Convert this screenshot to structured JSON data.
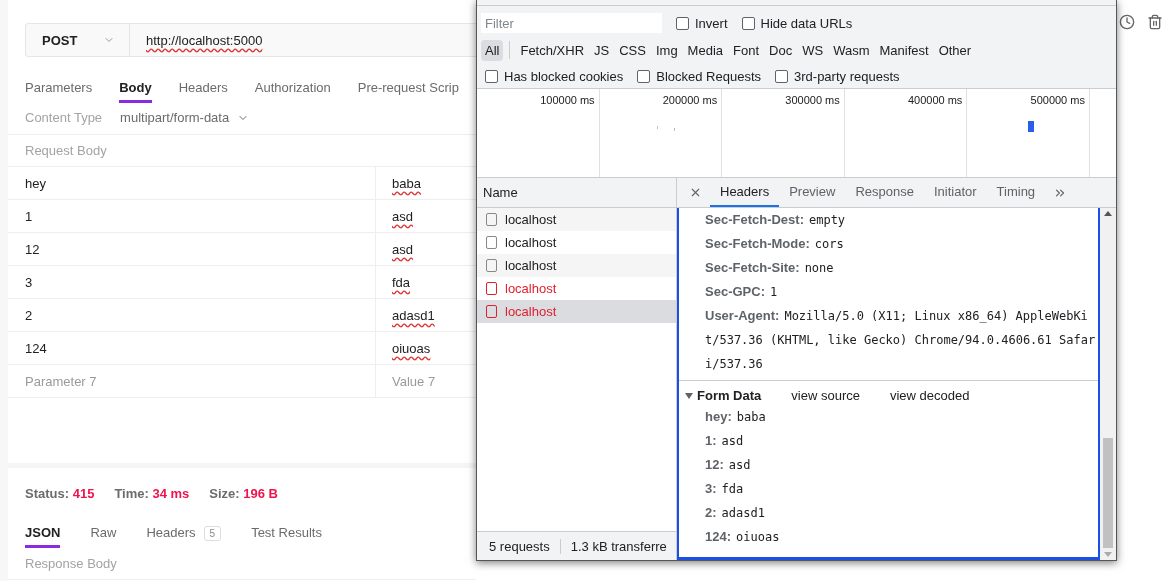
{
  "request": {
    "method": "POST",
    "url": "http://localhost:5000"
  },
  "request_tabs": [
    {
      "label": "Parameters",
      "selected": false
    },
    {
      "label": "Body",
      "selected": true
    },
    {
      "label": "Headers",
      "selected": false
    },
    {
      "label": "Authorization",
      "selected": false
    },
    {
      "label": "Pre-request Scrip",
      "selected": false
    }
  ],
  "content_type": {
    "label": "Content Type",
    "value": "multipart/form-data"
  },
  "request_body": {
    "title": "Request Body",
    "rows": [
      {
        "key": "hey",
        "value": "baba"
      },
      {
        "key": "1",
        "value": "asd"
      },
      {
        "key": "12",
        "value": "asd"
      },
      {
        "key": "3",
        "value": "fda"
      },
      {
        "key": "2",
        "value": "adasd1"
      },
      {
        "key": "124",
        "value": "oiuoas"
      }
    ],
    "placeholder_row": {
      "key": "Parameter 7",
      "value": "Value 7"
    }
  },
  "response_summary": [
    {
      "label": "Status:",
      "value": "415"
    },
    {
      "label": "Time:",
      "value": "34 ms"
    },
    {
      "label": "Size:",
      "value": "196 B"
    }
  ],
  "response_tabs": [
    {
      "label": "JSON",
      "selected": true
    },
    {
      "label": "Raw",
      "selected": false
    },
    {
      "label": "Headers",
      "count": "5",
      "selected": false
    },
    {
      "label": "Test Results",
      "selected": false
    }
  ],
  "response_body_title": "Response Body",
  "devtools": {
    "filter": {
      "placeholder": "Filter"
    },
    "filter_options": [
      {
        "label": "Invert",
        "checked": false
      },
      {
        "label": "Hide data URLs",
        "checked": false
      }
    ],
    "type_filters": [
      {
        "label": "All",
        "selected": true
      },
      {
        "label": "Fetch/XHR",
        "selected": false
      },
      {
        "label": "JS",
        "selected": false
      },
      {
        "label": "CSS",
        "selected": false
      },
      {
        "label": "Img",
        "selected": false
      },
      {
        "label": "Media",
        "selected": false
      },
      {
        "label": "Font",
        "selected": false
      },
      {
        "label": "Doc",
        "selected": false
      },
      {
        "label": "WS",
        "selected": false
      },
      {
        "label": "Wasm",
        "selected": false
      },
      {
        "label": "Manifest",
        "selected": false
      },
      {
        "label": "Other",
        "selected": false
      }
    ],
    "request_options": [
      {
        "label": "Has blocked cookies",
        "checked": false
      },
      {
        "label": "Blocked Requests",
        "checked": false
      },
      {
        "label": "3rd-party requests",
        "checked": false
      }
    ],
    "timeline_ticks": [
      "100000 ms",
      "200000 ms",
      "300000 ms",
      "400000 ms",
      "500000 ms"
    ],
    "requests_header": "Name",
    "requests": [
      {
        "name": "localhost",
        "failed": false,
        "selected": false
      },
      {
        "name": "localhost",
        "failed": false,
        "selected": false
      },
      {
        "name": "localhost",
        "failed": false,
        "selected": false
      },
      {
        "name": "localhost",
        "failed": true,
        "selected": false
      },
      {
        "name": "localhost",
        "failed": true,
        "selected": true
      }
    ],
    "detail_tabs": [
      {
        "label": "Headers",
        "selected": true
      },
      {
        "label": "Preview",
        "selected": false
      },
      {
        "label": "Response",
        "selected": false
      },
      {
        "label": "Initiator",
        "selected": false
      },
      {
        "label": "Timing",
        "selected": false
      }
    ],
    "headers": [
      {
        "name": "Sec-Fetch-Dest:",
        "value": "empty"
      },
      {
        "name": "Sec-Fetch-Mode:",
        "value": "cors"
      },
      {
        "name": "Sec-Fetch-Site:",
        "value": "none"
      },
      {
        "name": "Sec-GPC:",
        "value": "1"
      },
      {
        "name": "User-Agent:",
        "value": "Mozilla/5.0 (X11; Linux x86_64) AppleWebKit/537.36 (KHTML, like Gecko) Chrome/94.0.4606.61 Safari/537.36"
      }
    ],
    "form_data": {
      "title": "Form Data",
      "expanded": true,
      "links": [
        "view source",
        "view decoded"
      ],
      "fields": [
        {
          "name": "hey:",
          "value": "baba"
        },
        {
          "name": "1:",
          "value": "asd"
        },
        {
          "name": "12:",
          "value": "asd"
        },
        {
          "name": "3:",
          "value": "fda"
        },
        {
          "name": "2:",
          "value": "adasd1"
        },
        {
          "name": "124:",
          "value": "oiuoas"
        }
      ]
    },
    "status": [
      "5 requests",
      "1.3 kB transferre"
    ]
  }
}
